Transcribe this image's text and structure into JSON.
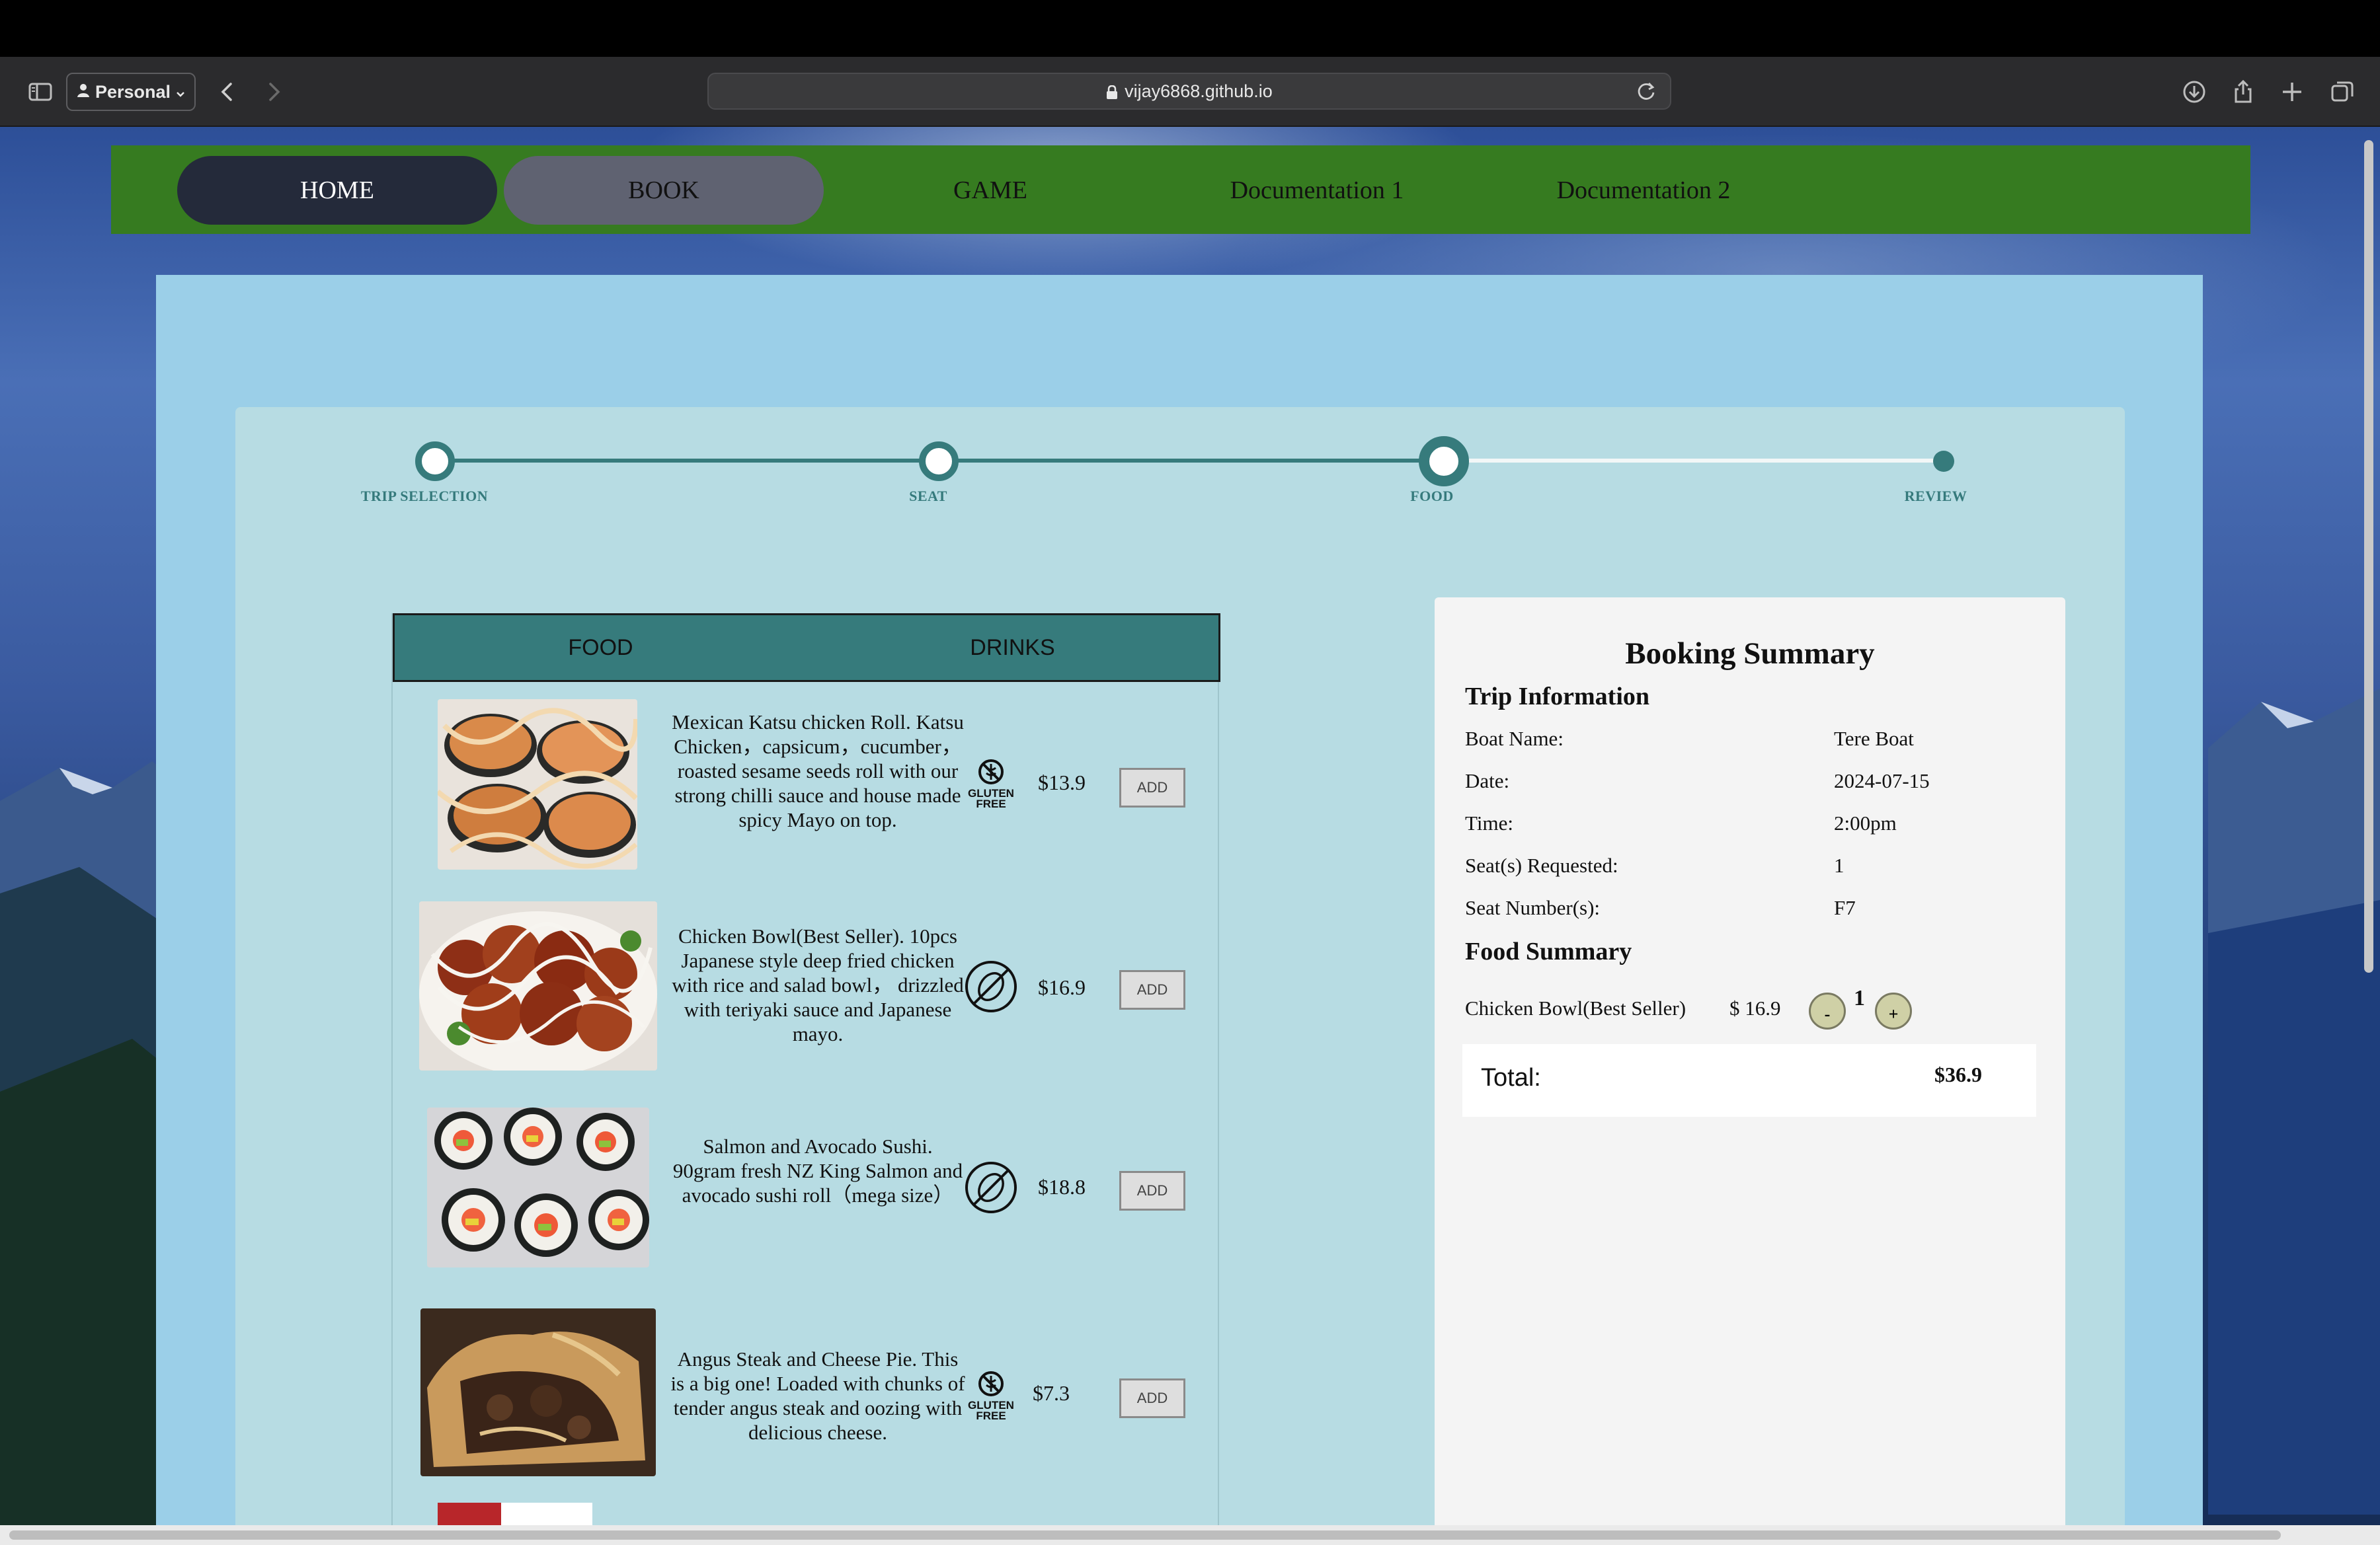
{
  "browser": {
    "profile_label": "Personal",
    "url": "vijay6868.github.io",
    "icons": [
      "sidebar-icon",
      "person-icon",
      "chevron-down-icon",
      "back-icon",
      "forward-icon",
      "lock-icon",
      "reload-icon",
      "download-icon",
      "share-icon",
      "new-tab-icon",
      "tabs-overview-icon"
    ]
  },
  "nav": {
    "items": [
      "HOME",
      "BOOK",
      "GAME",
      "Documentation 1",
      "Documentation 2"
    ],
    "active": "HOME",
    "hovered": "BOOK"
  },
  "stepper": {
    "steps": [
      "TRIP SELECTION",
      "SEAT",
      "FOOD",
      "REVIEW"
    ],
    "current_step": "FOOD",
    "accent_color": "#367b7c"
  },
  "menu": {
    "tabs": [
      "FOOD",
      "DRINKS"
    ],
    "items": [
      {
        "description": "Mexican Katsu chicken Roll. Katsu Chicken，capsicum，cucumber，roasted sesame seeds roll with our strong chilli sauce and house made spicy Mayo on top.",
        "price": "$13.9",
        "diet_icon": "gluten-free-icon",
        "add_label": "ADD"
      },
      {
        "description": "Chicken Bowl(Best Seller). 10pcs Japanese style deep fried chicken with rice and salad bowl， drizzled with teriyaki sauce and Japanese mayo.",
        "price": "$16.9",
        "diet_icon": "no-nuts-icon",
        "add_label": "ADD"
      },
      {
        "description": "Salmon and Avocado Sushi. 90gram fresh NZ King Salmon and avocado sushi roll（mega size）",
        "price": "$18.8",
        "diet_icon": "no-nuts-icon",
        "add_label": "ADD"
      },
      {
        "description": "Angus Steak and Cheese Pie. This is a big one! Loaded with chunks of tender angus steak and oozing with delicious cheese.",
        "price": "$7.3",
        "diet_icon": "gluten-free-icon",
        "add_label": "ADD"
      }
    ],
    "gluten_free_text": [
      "GLUTEN",
      "FREE"
    ]
  },
  "summary": {
    "title": "Booking Summary",
    "trip_heading": "Trip Information",
    "rows": [
      {
        "label": "Boat Name:",
        "value": "Tere Boat"
      },
      {
        "label": "Date:",
        "value": "2024-07-15"
      },
      {
        "label": "Time:",
        "value": "2:00pm"
      },
      {
        "label": "Seat(s) Requested:",
        "value": "1"
      },
      {
        "label": "Seat Number(s):",
        "value": "F7"
      }
    ],
    "food_heading": "Food Summary",
    "food_items": [
      {
        "name": "Chicken Bowl(Best Seller)",
        "price": "$ 16.9",
        "qty": "1",
        "minus": "-",
        "plus": "+"
      }
    ],
    "total_label": "Total:",
    "total_value": "$36.9"
  },
  "colors": {
    "navbar": "#367b20",
    "nav_active": "#242a3a",
    "nav_hover": "#5f6271",
    "accent": "#367b7c",
    "outer_panel": "#9bcfe8",
    "inner_panel": "#b7dce3"
  }
}
